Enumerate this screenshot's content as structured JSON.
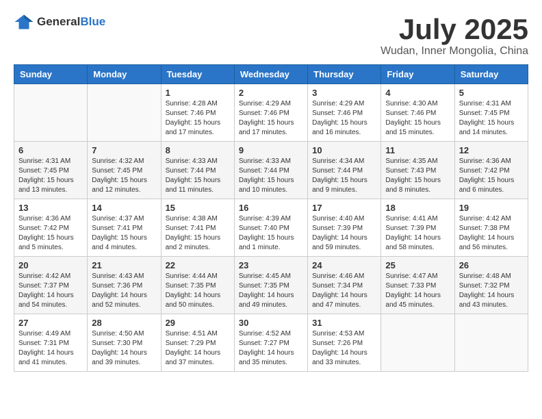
{
  "header": {
    "logo_general": "General",
    "logo_blue": "Blue",
    "main_title": "July 2025",
    "subtitle": "Wudan, Inner Mongolia, China"
  },
  "days_of_week": [
    "Sunday",
    "Monday",
    "Tuesday",
    "Wednesday",
    "Thursday",
    "Friday",
    "Saturday"
  ],
  "weeks": [
    [
      {
        "day": "",
        "detail": ""
      },
      {
        "day": "",
        "detail": ""
      },
      {
        "day": "1",
        "detail": "Sunrise: 4:28 AM\nSunset: 7:46 PM\nDaylight: 15 hours\nand 17 minutes."
      },
      {
        "day": "2",
        "detail": "Sunrise: 4:29 AM\nSunset: 7:46 PM\nDaylight: 15 hours\nand 17 minutes."
      },
      {
        "day": "3",
        "detail": "Sunrise: 4:29 AM\nSunset: 7:46 PM\nDaylight: 15 hours\nand 16 minutes."
      },
      {
        "day": "4",
        "detail": "Sunrise: 4:30 AM\nSunset: 7:46 PM\nDaylight: 15 hours\nand 15 minutes."
      },
      {
        "day": "5",
        "detail": "Sunrise: 4:31 AM\nSunset: 7:45 PM\nDaylight: 15 hours\nand 14 minutes."
      }
    ],
    [
      {
        "day": "6",
        "detail": "Sunrise: 4:31 AM\nSunset: 7:45 PM\nDaylight: 15 hours\nand 13 minutes."
      },
      {
        "day": "7",
        "detail": "Sunrise: 4:32 AM\nSunset: 7:45 PM\nDaylight: 15 hours\nand 12 minutes."
      },
      {
        "day": "8",
        "detail": "Sunrise: 4:33 AM\nSunset: 7:44 PM\nDaylight: 15 hours\nand 11 minutes."
      },
      {
        "day": "9",
        "detail": "Sunrise: 4:33 AM\nSunset: 7:44 PM\nDaylight: 15 hours\nand 10 minutes."
      },
      {
        "day": "10",
        "detail": "Sunrise: 4:34 AM\nSunset: 7:44 PM\nDaylight: 15 hours\nand 9 minutes."
      },
      {
        "day": "11",
        "detail": "Sunrise: 4:35 AM\nSunset: 7:43 PM\nDaylight: 15 hours\nand 8 minutes."
      },
      {
        "day": "12",
        "detail": "Sunrise: 4:36 AM\nSunset: 7:42 PM\nDaylight: 15 hours\nand 6 minutes."
      }
    ],
    [
      {
        "day": "13",
        "detail": "Sunrise: 4:36 AM\nSunset: 7:42 PM\nDaylight: 15 hours\nand 5 minutes."
      },
      {
        "day": "14",
        "detail": "Sunrise: 4:37 AM\nSunset: 7:41 PM\nDaylight: 15 hours\nand 4 minutes."
      },
      {
        "day": "15",
        "detail": "Sunrise: 4:38 AM\nSunset: 7:41 PM\nDaylight: 15 hours\nand 2 minutes."
      },
      {
        "day": "16",
        "detail": "Sunrise: 4:39 AM\nSunset: 7:40 PM\nDaylight: 15 hours\nand 1 minute."
      },
      {
        "day": "17",
        "detail": "Sunrise: 4:40 AM\nSunset: 7:39 PM\nDaylight: 14 hours\nand 59 minutes."
      },
      {
        "day": "18",
        "detail": "Sunrise: 4:41 AM\nSunset: 7:39 PM\nDaylight: 14 hours\nand 58 minutes."
      },
      {
        "day": "19",
        "detail": "Sunrise: 4:42 AM\nSunset: 7:38 PM\nDaylight: 14 hours\nand 56 minutes."
      }
    ],
    [
      {
        "day": "20",
        "detail": "Sunrise: 4:42 AM\nSunset: 7:37 PM\nDaylight: 14 hours\nand 54 minutes."
      },
      {
        "day": "21",
        "detail": "Sunrise: 4:43 AM\nSunset: 7:36 PM\nDaylight: 14 hours\nand 52 minutes."
      },
      {
        "day": "22",
        "detail": "Sunrise: 4:44 AM\nSunset: 7:35 PM\nDaylight: 14 hours\nand 50 minutes."
      },
      {
        "day": "23",
        "detail": "Sunrise: 4:45 AM\nSunset: 7:35 PM\nDaylight: 14 hours\nand 49 minutes."
      },
      {
        "day": "24",
        "detail": "Sunrise: 4:46 AM\nSunset: 7:34 PM\nDaylight: 14 hours\nand 47 minutes."
      },
      {
        "day": "25",
        "detail": "Sunrise: 4:47 AM\nSunset: 7:33 PM\nDaylight: 14 hours\nand 45 minutes."
      },
      {
        "day": "26",
        "detail": "Sunrise: 4:48 AM\nSunset: 7:32 PM\nDaylight: 14 hours\nand 43 minutes."
      }
    ],
    [
      {
        "day": "27",
        "detail": "Sunrise: 4:49 AM\nSunset: 7:31 PM\nDaylight: 14 hours\nand 41 minutes."
      },
      {
        "day": "28",
        "detail": "Sunrise: 4:50 AM\nSunset: 7:30 PM\nDaylight: 14 hours\nand 39 minutes."
      },
      {
        "day": "29",
        "detail": "Sunrise: 4:51 AM\nSunset: 7:29 PM\nDaylight: 14 hours\nand 37 minutes."
      },
      {
        "day": "30",
        "detail": "Sunrise: 4:52 AM\nSunset: 7:27 PM\nDaylight: 14 hours\nand 35 minutes."
      },
      {
        "day": "31",
        "detail": "Sunrise: 4:53 AM\nSunset: 7:26 PM\nDaylight: 14 hours\nand 33 minutes."
      },
      {
        "day": "",
        "detail": ""
      },
      {
        "day": "",
        "detail": ""
      }
    ]
  ]
}
